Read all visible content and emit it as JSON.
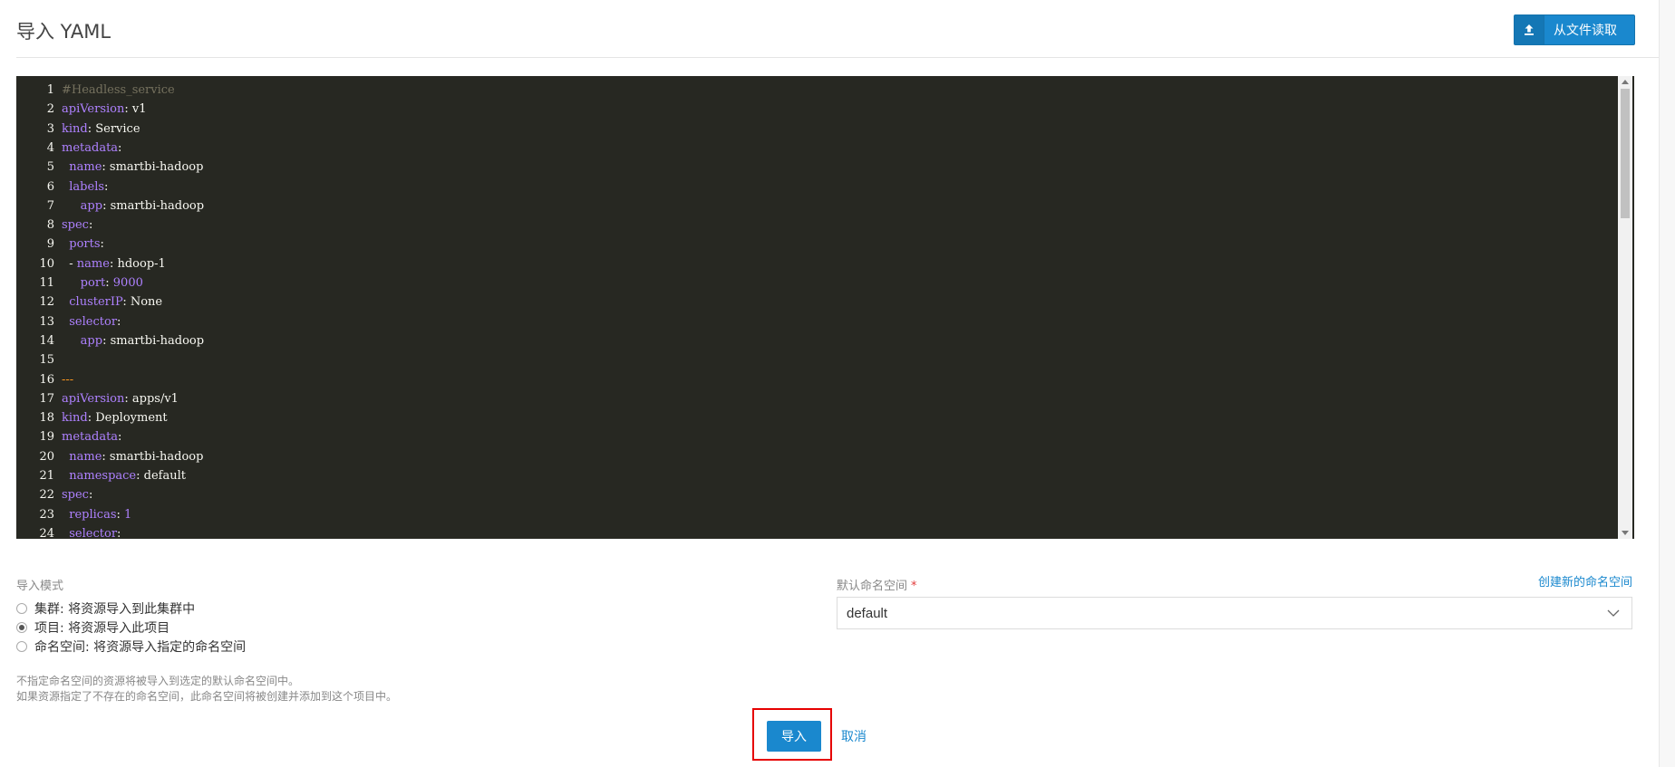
{
  "header": {
    "title": "导入 YAML",
    "read_file_label": "从文件读取",
    "read_file_icon": "upload-icon"
  },
  "editor": {
    "lines": [
      {
        "n": "1",
        "t": [
          [
            "comment",
            "#Headless_service"
          ]
        ]
      },
      {
        "n": "2",
        "t": [
          [
            "key",
            "apiVersion"
          ],
          [
            "plain",
            ": v1"
          ]
        ]
      },
      {
        "n": "3",
        "t": [
          [
            "key",
            "kind"
          ],
          [
            "plain",
            ": Service"
          ]
        ]
      },
      {
        "n": "4",
        "t": [
          [
            "key",
            "metadata"
          ],
          [
            "plain",
            ":"
          ]
        ]
      },
      {
        "n": "5",
        "t": [
          [
            "plain",
            "  "
          ],
          [
            "key",
            "name"
          ],
          [
            "plain",
            ": smartbi-hadoop"
          ]
        ]
      },
      {
        "n": "6",
        "t": [
          [
            "plain",
            "  "
          ],
          [
            "key",
            "labels"
          ],
          [
            "plain",
            ":"
          ]
        ]
      },
      {
        "n": "7",
        "t": [
          [
            "plain",
            "     "
          ],
          [
            "key",
            "app"
          ],
          [
            "plain",
            ": smartbi-hadoop"
          ]
        ]
      },
      {
        "n": "8",
        "t": [
          [
            "key",
            "spec"
          ],
          [
            "plain",
            ":"
          ]
        ]
      },
      {
        "n": "9",
        "t": [
          [
            "plain",
            "  "
          ],
          [
            "key",
            "ports"
          ],
          [
            "plain",
            ":"
          ]
        ]
      },
      {
        "n": "10",
        "t": [
          [
            "plain",
            "  - "
          ],
          [
            "key",
            "name"
          ],
          [
            "plain",
            ": hdoop-1"
          ]
        ]
      },
      {
        "n": "11",
        "t": [
          [
            "plain",
            "     "
          ],
          [
            "key",
            "port"
          ],
          [
            "plain",
            ": "
          ],
          [
            "num",
            "9000"
          ]
        ]
      },
      {
        "n": "12",
        "t": [
          [
            "plain",
            "  "
          ],
          [
            "key",
            "clusterIP"
          ],
          [
            "plain",
            ": None"
          ]
        ]
      },
      {
        "n": "13",
        "t": [
          [
            "plain",
            "  "
          ],
          [
            "key",
            "selector"
          ],
          [
            "plain",
            ":"
          ]
        ]
      },
      {
        "n": "14",
        "t": [
          [
            "plain",
            "     "
          ],
          [
            "key",
            "app"
          ],
          [
            "plain",
            ": smartbi-hadoop"
          ]
        ]
      },
      {
        "n": "15",
        "t": []
      },
      {
        "n": "16",
        "t": [
          [
            "doc",
            "---"
          ]
        ]
      },
      {
        "n": "17",
        "t": [
          [
            "key",
            "apiVersion"
          ],
          [
            "plain",
            ": apps/v1"
          ]
        ]
      },
      {
        "n": "18",
        "t": [
          [
            "key",
            "kind"
          ],
          [
            "plain",
            ": Deployment"
          ]
        ]
      },
      {
        "n": "19",
        "t": [
          [
            "key",
            "metadata"
          ],
          [
            "plain",
            ":"
          ]
        ]
      },
      {
        "n": "20",
        "t": [
          [
            "plain",
            "  "
          ],
          [
            "key",
            "name"
          ],
          [
            "plain",
            ": smartbi-hadoop"
          ]
        ]
      },
      {
        "n": "21",
        "t": [
          [
            "plain",
            "  "
          ],
          [
            "key",
            "namespace"
          ],
          [
            "plain",
            ": default"
          ]
        ]
      },
      {
        "n": "22",
        "t": [
          [
            "key",
            "spec"
          ],
          [
            "plain",
            ":"
          ]
        ]
      },
      {
        "n": "23",
        "t": [
          [
            "plain",
            "  "
          ],
          [
            "key",
            "replicas"
          ],
          [
            "plain",
            ": "
          ],
          [
            "num",
            "1"
          ]
        ]
      },
      {
        "n": "24",
        "t": [
          [
            "plain",
            "  "
          ],
          [
            "key",
            "selector"
          ],
          [
            "plain",
            ":"
          ]
        ]
      }
    ]
  },
  "import_mode": {
    "label": "导入模式",
    "options": [
      {
        "label": "集群: 将资源导入到此集群中",
        "checked": false
      },
      {
        "label": "项目: 将资源导入此项目",
        "checked": true
      },
      {
        "label": "命名空间: 将资源导入指定的命名空间",
        "checked": false
      }
    ]
  },
  "namespace": {
    "label": "默认命名空间",
    "required_mark": "*",
    "create_link": "创建新的命名空间",
    "selected": "default"
  },
  "hints": [
    "不指定命名空间的资源将被导入到选定的默认命名空间中。",
    "如果资源指定了不存在的命名空间，此命名空间将被创建并添加到这个项目中。"
  ],
  "actions": {
    "import_label": "导入",
    "cancel_label": "取消"
  },
  "colors": {
    "primary": "#1a88ce",
    "editor_bg": "#272822",
    "highlight": "#e60000"
  }
}
